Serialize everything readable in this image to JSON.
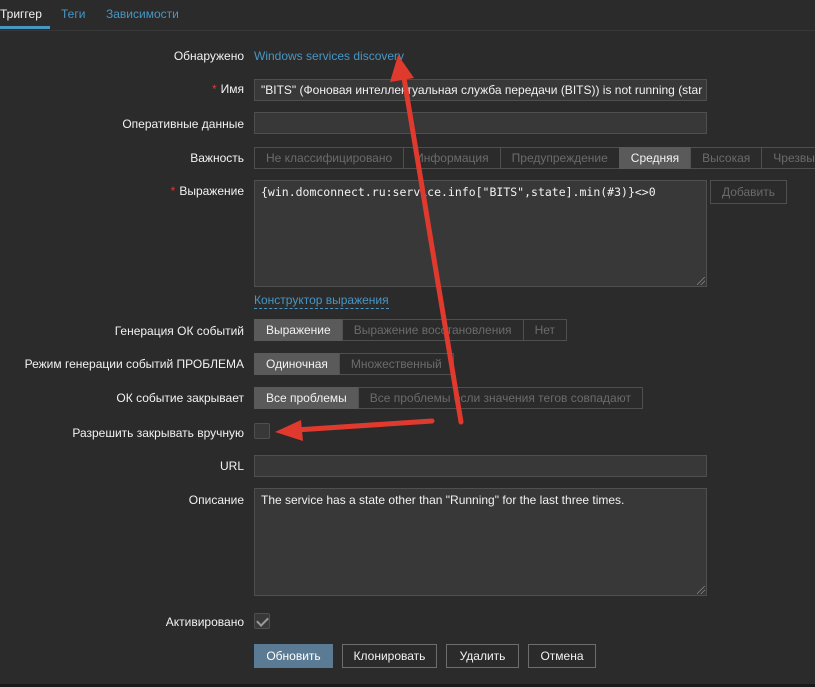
{
  "tabs": [
    {
      "label": "Триггер"
    },
    {
      "label": "Теги"
    },
    {
      "label": "Зависимости"
    }
  ],
  "form": {
    "discovered": {
      "label": "Обнаружено",
      "value": "Windows services discovery"
    },
    "name": {
      "label": "Имя",
      "required": "*",
      "value": "\"BITS\" (Фоновая интеллектуальная служба передачи (BITS)) is not running (star"
    },
    "opdata": {
      "label": "Оперативные данные",
      "value": ""
    },
    "severity": {
      "label": "Важность",
      "options": [
        "Не классифицировано",
        "Информация",
        "Предупреждение",
        "Средняя",
        "Высокая",
        "Чрезвы"
      ],
      "selected": "Средняя"
    },
    "expression": {
      "label": "Выражение",
      "required": "*",
      "value": "{win.domconnect.ru:service.info[\"BITS\",state].min(#3)}<>0",
      "add_button": "Добавить",
      "constructor_link": "Конструктор выражения"
    },
    "ok_generation": {
      "label": "Генерация ОК событий",
      "options": [
        "Выражение",
        "Выражение восстановления",
        "Нет"
      ],
      "selected": "Выражение"
    },
    "problem_mode": {
      "label": "Режим генерации событий ПРОБЛЕМА",
      "options": [
        "Одиночная",
        "Множественный"
      ],
      "selected": "Одиночная"
    },
    "ok_closes": {
      "label": "ОК событие закрывает",
      "options": [
        "Все проблемы",
        "Все проблемы если значения тегов совпадают"
      ],
      "selected": "Все проблемы"
    },
    "manual_close": {
      "label": "Разрешить закрывать вручную",
      "checked": false
    },
    "url": {
      "label": "URL",
      "value": ""
    },
    "description": {
      "label": "Описание",
      "value": "The service has a state other than \"Running\" for the last three times."
    },
    "enabled": {
      "label": "Активировано",
      "checked": true
    }
  },
  "buttons": {
    "update": "Обновить",
    "clone": "Клонировать",
    "delete": "Удалить",
    "cancel": "Отмена"
  },
  "colors": {
    "background": "#2b2b2b",
    "link": "#4796c4",
    "required": "#e33734",
    "primary_button": "#5a7b93",
    "annotation_arrow": "#e03a2f"
  }
}
